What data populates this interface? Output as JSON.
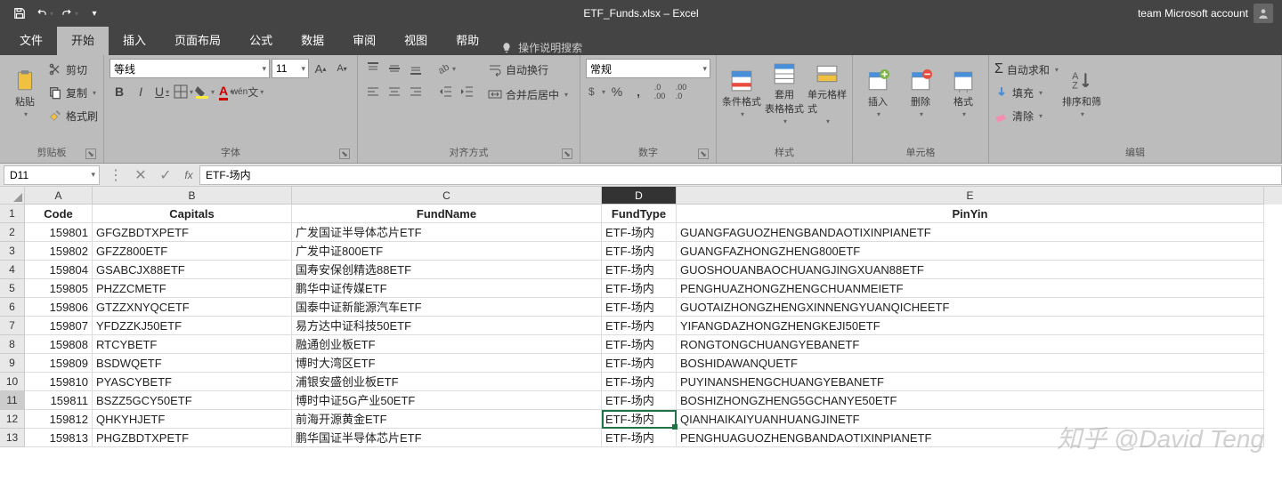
{
  "title": "ETF_Funds.xlsx  –  Excel",
  "account": "team Microsoft account",
  "tabs": [
    "文件",
    "开始",
    "插入",
    "页面布局",
    "公式",
    "数据",
    "审阅",
    "视图",
    "帮助"
  ],
  "tellme": "操作说明搜索",
  "clipboard": {
    "paste": "粘贴",
    "cut": "剪切",
    "copy": "复制",
    "painter": "格式刷",
    "label": "剪贴板"
  },
  "font": {
    "name": "等线",
    "size": "11",
    "label": "字体"
  },
  "align": {
    "wrap": "自动换行",
    "merge": "合并后居中",
    "label": "对齐方式"
  },
  "number": {
    "format": "常规",
    "label": "数字"
  },
  "styles": {
    "cond": "条件格式",
    "table": "套用\n表格格式",
    "cell": "单元格样式",
    "label": "样式"
  },
  "cells": {
    "insert": "插入",
    "delete": "删除",
    "format": "格式",
    "label": "单元格"
  },
  "editing": {
    "sum": "自动求和",
    "fill": "填充",
    "clear": "清除",
    "sort": "排序和筛",
    "label": "编辑"
  },
  "namebox": "D11",
  "formula": "ETF-场内",
  "columns": [
    "A",
    "B",
    "C",
    "D",
    "E"
  ],
  "headers": {
    "A": "Code",
    "B": "Capitals",
    "C": "FundName",
    "D": "FundType",
    "E": "PinYin"
  },
  "rows": [
    {
      "n": 2,
      "A": "159801",
      "B": "GFGZBDTXPETF",
      "C": "广发国证半导体芯片ETF",
      "D": "ETF-场内",
      "E": "GUANGFAGUOZHENGBANDAOTIXINPIANETF"
    },
    {
      "n": 3,
      "A": "159802",
      "B": "GFZZ800ETF",
      "C": "广发中证800ETF",
      "D": "ETF-场内",
      "E": "GUANGFAZHONGZHENG800ETF"
    },
    {
      "n": 4,
      "A": "159804",
      "B": "GSABCJX88ETF",
      "C": "国寿安保创精选88ETF",
      "D": "ETF-场内",
      "E": "GUOSHOUANBAOCHUANGJINGXUAN88ETF"
    },
    {
      "n": 5,
      "A": "159805",
      "B": "PHZZCMETF",
      "C": "鹏华中证传媒ETF",
      "D": "ETF-场内",
      "E": "PENGHUAZHONGZHENGCHUANMEIETF"
    },
    {
      "n": 6,
      "A": "159806",
      "B": "GTZZXNYQCETF",
      "C": "国泰中证新能源汽车ETF",
      "D": "ETF-场内",
      "E": "GUOTAIZHONGZHENGXINNENGYUANQICHEETF"
    },
    {
      "n": 7,
      "A": "159807",
      "B": "YFDZZKJ50ETF",
      "C": "易方达中证科技50ETF",
      "D": "ETF-场内",
      "E": "YIFANGDAZHONGZHENGKEJI50ETF"
    },
    {
      "n": 8,
      "A": "159808",
      "B": "RTCYBETF",
      "C": "融通创业板ETF",
      "D": "ETF-场内",
      "E": "RONGTONGCHUANGYEBANETF"
    },
    {
      "n": 9,
      "A": "159809",
      "B": "BSDWQETF",
      "C": "博时大湾区ETF",
      "D": "ETF-场内",
      "E": "BOSHIDAWANQUETF"
    },
    {
      "n": 10,
      "A": "159810",
      "B": "PYASCYBETF",
      "C": "浦银安盛创业板ETF",
      "D": "ETF-场内",
      "E": "PUYINANSHENGCHUANGYEBANETF"
    },
    {
      "n": 11,
      "A": "159811",
      "B": "BSZZ5GCY50ETF",
      "C": "博时中证5G产业50ETF",
      "D": "ETF-场内",
      "E": "BOSHIZHONGZHENG5GCHANYE50ETF"
    },
    {
      "n": 12,
      "A": "159812",
      "B": "QHKYHJETF",
      "C": "前海开源黄金ETF",
      "D": "ETF-场内",
      "E": "QIANHAIKAIYUANHUANGJINETF"
    },
    {
      "n": 13,
      "A": "159813",
      "B": "PHGZBDTXPETF",
      "C": "鹏华国证半导体芯片ETF",
      "D": "ETF-场内",
      "E": "PENGHUAGUOZHENGBANDAOTIXINPIANETF"
    }
  ],
  "watermark": "知乎 @David Teng"
}
